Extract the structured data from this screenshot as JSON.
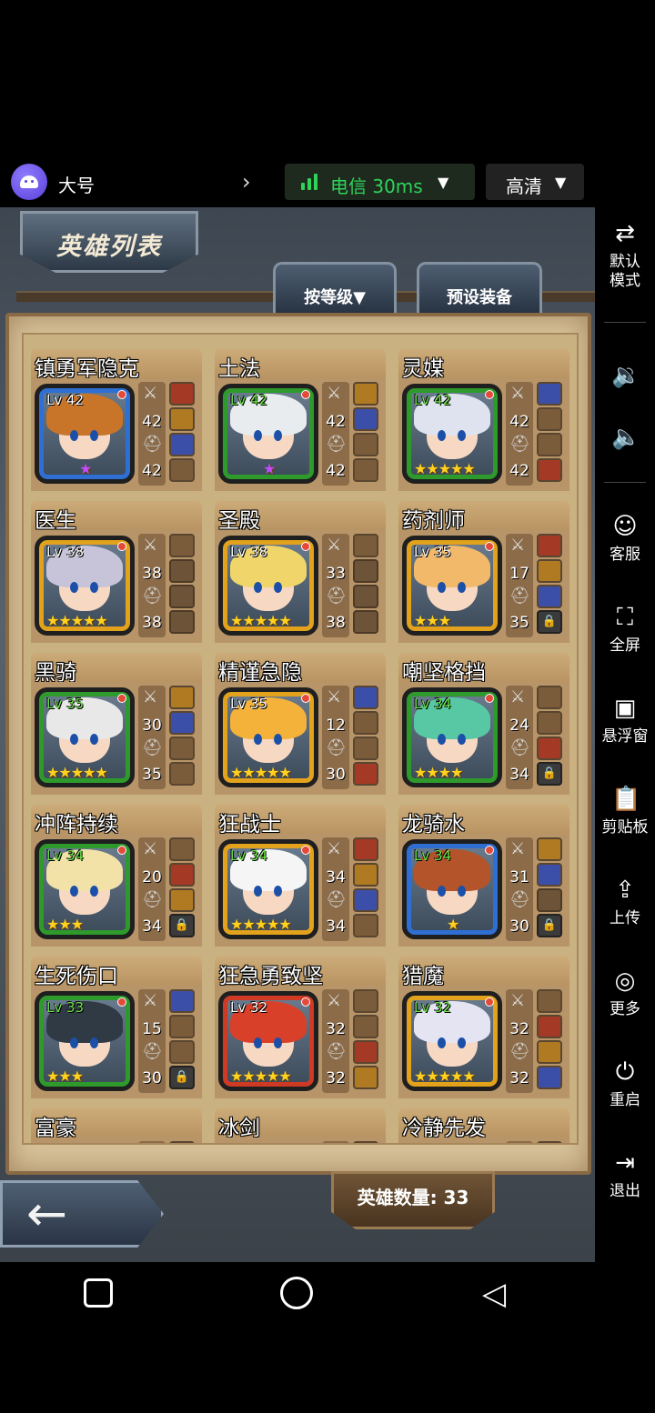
{
  "account": {
    "name": "大号"
  },
  "network": {
    "label": "电信 30ms"
  },
  "quality": {
    "label": "高清"
  },
  "sidebar": {
    "items": [
      {
        "icon": "⇄",
        "label": "默认\n模式"
      },
      {
        "icon": "🔉",
        "label": ""
      },
      {
        "icon": "🔈",
        "label": ""
      },
      {
        "icon": "☺",
        "label": "客服"
      },
      {
        "icon": "⛶",
        "label": "全屏"
      },
      {
        "icon": "▣",
        "label": "悬浮窗"
      },
      {
        "icon": "📋",
        "label": "剪贴板"
      },
      {
        "icon": "⇪",
        "label": "上传"
      },
      {
        "icon": "◎",
        "label": "更多"
      },
      {
        "icon": "⏻",
        "label": "重启"
      },
      {
        "icon": "⇥",
        "label": "退出"
      }
    ]
  },
  "game": {
    "title": "英雄列表",
    "tab_sort": "按等级▼",
    "tab_preset": "预设装备",
    "hero_count": "英雄数量: 33",
    "back_arrow": "←"
  },
  "heroes": [
    {
      "name": "镇勇军隐克",
      "lv": "Lv 42",
      "atk": "42",
      "def": "42",
      "stars": "★",
      "star_color": "purple",
      "frame": "blue"
    },
    {
      "name": "土法",
      "lv": "Lv 42",
      "atk": "42",
      "def": "42",
      "stars": "★",
      "star_color": "purple",
      "frame": "green"
    },
    {
      "name": "灵媒",
      "lv": "Lv 42",
      "atk": "42",
      "def": "42",
      "stars": "★★★★★",
      "star_color": "gold",
      "frame": "green"
    },
    {
      "name": "医生",
      "lv": "Lv 38",
      "atk": "38",
      "def": "38",
      "stars": "★★★★★",
      "star_color": "gold",
      "frame": "gold"
    },
    {
      "name": "圣殿",
      "lv": "Lv 38",
      "atk": "33",
      "def": "38",
      "stars": "★★★★★",
      "star_color": "gold",
      "frame": "gold"
    },
    {
      "name": "药剂师",
      "lv": "Lv 35",
      "atk": "17",
      "def": "35",
      "stars": "★★★",
      "star_color": "gold",
      "frame": "gold"
    },
    {
      "name": "黑骑",
      "lv": "Lv 35",
      "atk": "30",
      "def": "35",
      "stars": "★★★★★",
      "star_color": "gold",
      "frame": "green"
    },
    {
      "name": "精谨急隐",
      "lv": "Lv 35",
      "atk": "12",
      "def": "30",
      "stars": "★★★★★",
      "star_color": "gold",
      "frame": "gold"
    },
    {
      "name": "嘲坚格挡",
      "lv": "Lv 34",
      "atk": "24",
      "def": "34",
      "stars": "★★★★",
      "star_color": "gold",
      "frame": "green"
    },
    {
      "name": "冲阵持续",
      "lv": "Lv 34",
      "atk": "20",
      "def": "34",
      "stars": "★★★",
      "star_color": "gold",
      "frame": "green"
    },
    {
      "name": "狂战士",
      "lv": "Lv 34",
      "atk": "34",
      "def": "34",
      "stars": "★★★★★",
      "star_color": "gold",
      "frame": "gold"
    },
    {
      "name": "龙骑水",
      "lv": "Lv 34",
      "atk": "31",
      "def": "30",
      "stars": "★",
      "star_color": "gold",
      "frame": "blue"
    },
    {
      "name": "生死伤口",
      "lv": "Lv 33",
      "atk": "15",
      "def": "30",
      "stars": "★★★",
      "star_color": "gold",
      "frame": "green"
    },
    {
      "name": "狂急勇致坚",
      "lv": "Lv 32",
      "atk": "32",
      "def": "32",
      "stars": "★★★★★",
      "star_color": "gold",
      "frame": "red"
    },
    {
      "name": "猎魔",
      "lv": "Lv 32",
      "atk": "32",
      "def": "32",
      "stars": "★★★★★",
      "star_color": "gold",
      "frame": "gold"
    },
    {
      "name": "富豪",
      "lv": "",
      "atk": "",
      "def": "",
      "stars": "",
      "star_color": "gold",
      "frame": "gold"
    },
    {
      "name": "冰剑",
      "lv": "",
      "atk": "",
      "def": "",
      "stars": "",
      "star_color": "gold",
      "frame": "blue"
    },
    {
      "name": "冷静先发",
      "lv": "",
      "atk": "",
      "def": "",
      "stars": "",
      "star_color": "gold",
      "frame": "gold"
    }
  ]
}
